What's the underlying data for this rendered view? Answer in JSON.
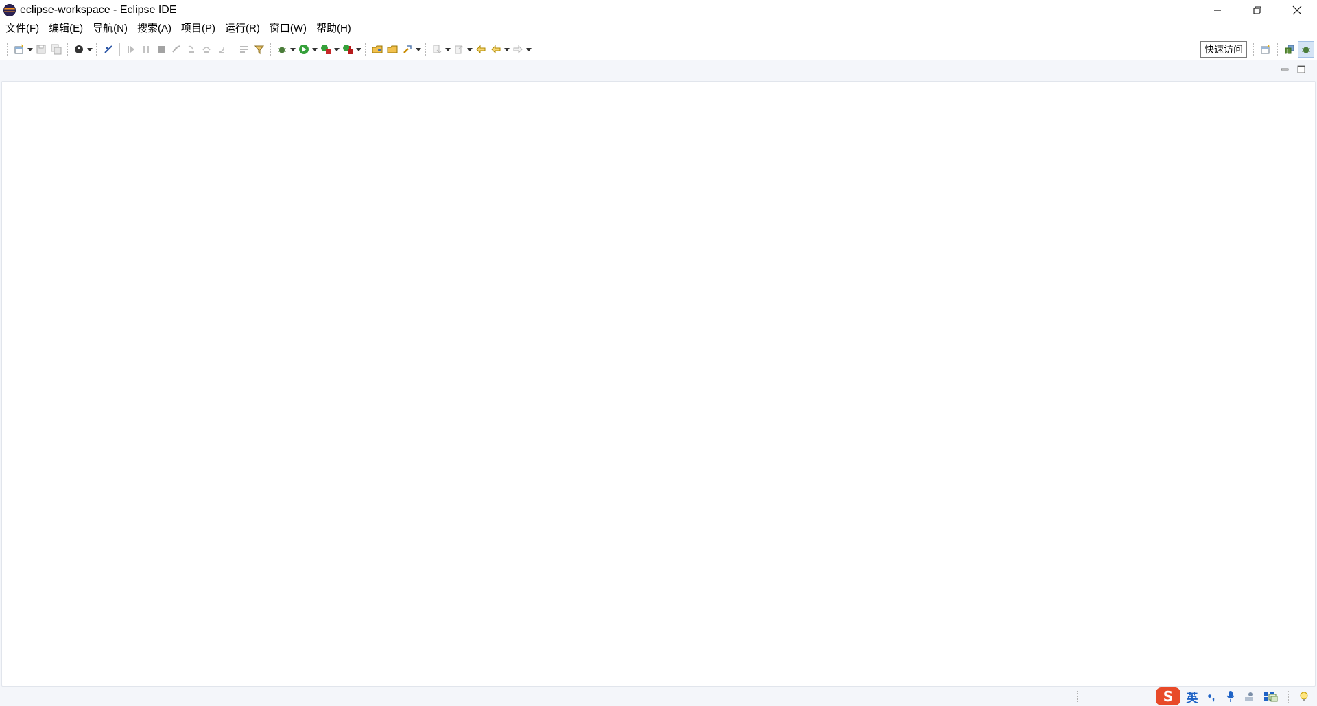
{
  "window": {
    "title": "eclipse-workspace - Eclipse IDE",
    "minimize_glyph": "—",
    "restore_glyph": "❐",
    "close_glyph": "✕"
  },
  "menu": {
    "items": [
      {
        "label": "文件(F)"
      },
      {
        "label": "编辑(E)"
      },
      {
        "label": "导航(N)"
      },
      {
        "label": "搜索(A)"
      },
      {
        "label": "项目(P)"
      },
      {
        "label": "运行(R)"
      },
      {
        "label": "窗口(W)"
      },
      {
        "label": "帮助(H)"
      }
    ]
  },
  "toolbar": {
    "quick_access_label": "快速访问",
    "buttons": [
      "new-icon",
      "save-icon",
      "save-all-icon",
      "profile-icon",
      "skip-breakpoints-icon",
      "resume-icon",
      "suspend-icon",
      "terminate-icon",
      "disconnect-icon",
      "step-into-icon",
      "step-over-icon",
      "step-return-icon",
      "drop-to-frame-icon",
      "use-step-filters-icon",
      "debug-icon",
      "run-icon",
      "coverage-icon",
      "external-tools-icon",
      "open-type-icon",
      "open-task-icon",
      "search-icon",
      "next-annotation-icon",
      "previous-annotation-icon",
      "last-edit-location-icon",
      "back-icon",
      "forward-icon"
    ],
    "perspectives": [
      "open-perspective-icon",
      "java-perspective-icon",
      "debug-perspective-icon"
    ]
  },
  "ime": {
    "logo_label": "S",
    "lang_label": "英",
    "punct_label": "•,"
  },
  "colors": {
    "editor_background": "#f4f6fa",
    "accent": "#1f63c6",
    "ime_brand": "#e84a29"
  }
}
